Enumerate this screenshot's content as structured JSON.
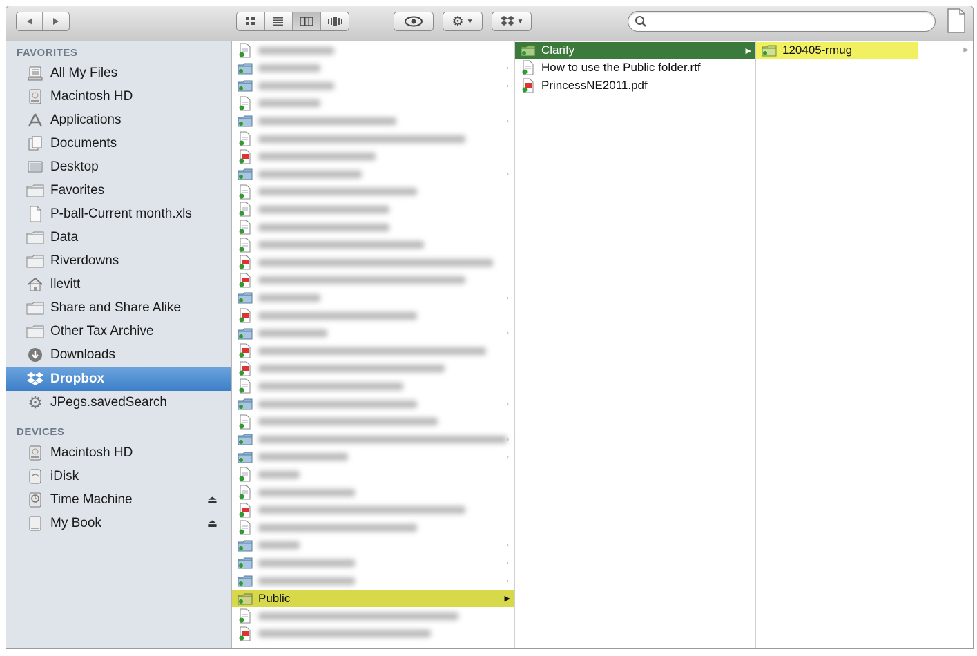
{
  "toolbar": {
    "view_modes": [
      "icon-view",
      "list-view",
      "column-view",
      "coverflow-view"
    ],
    "active_view": "column-view",
    "search_placeholder": ""
  },
  "sidebar": {
    "favorites_header": "FAVORITES",
    "favorites": [
      {
        "label": "All My Files",
        "icon": "all-files-icon"
      },
      {
        "label": "Macintosh HD",
        "icon": "hard-drive-icon"
      },
      {
        "label": "Applications",
        "icon": "applications-icon"
      },
      {
        "label": "Documents",
        "icon": "documents-icon"
      },
      {
        "label": "Desktop",
        "icon": "desktop-icon"
      },
      {
        "label": "Favorites",
        "icon": "folder-icon"
      },
      {
        "label": "P-ball-Current month.xls",
        "icon": "document-icon"
      },
      {
        "label": "Data",
        "icon": "folder-icon"
      },
      {
        "label": "Riverdowns",
        "icon": "folder-icon"
      },
      {
        "label": "llevitt",
        "icon": "home-icon"
      },
      {
        "label": "Share and Share Alike",
        "icon": "folder-icon"
      },
      {
        "label": "Other Tax Archive",
        "icon": "folder-icon"
      },
      {
        "label": "Downloads",
        "icon": "downloads-icon"
      },
      {
        "label": "Dropbox",
        "icon": "dropbox-icon",
        "selected": true
      },
      {
        "label": "JPegs.savedSearch",
        "icon": "gear-icon"
      }
    ],
    "devices_header": "DEVICES",
    "devices": [
      {
        "label": "Macintosh HD",
        "icon": "hard-drive-icon",
        "eject": false
      },
      {
        "label": "iDisk",
        "icon": "idisk-icon",
        "eject": false
      },
      {
        "label": "Time Machine",
        "icon": "time-machine-icon",
        "eject": true
      },
      {
        "label": "My Book",
        "icon": "external-drive-icon",
        "eject": true
      }
    ]
  },
  "column1": {
    "selected_label": "Public"
  },
  "column2": {
    "items": [
      {
        "label": "Clarify",
        "type": "folder",
        "selected": true
      },
      {
        "label": "How to use the Public folder.rtf",
        "type": "rtf"
      },
      {
        "label": "PrincessNE2011.pdf",
        "type": "pdf"
      }
    ]
  },
  "column3": {
    "items": [
      {
        "label": "120405-rmug",
        "type": "folder"
      }
    ]
  },
  "colors": {
    "selection_blue": "#3d7fc8",
    "public_highlight": "#d8d94a",
    "clarify_highlight": "#3b7a3b",
    "rmug_highlight": "#f0f061",
    "sidebar_bg": "#dfe4ea"
  }
}
